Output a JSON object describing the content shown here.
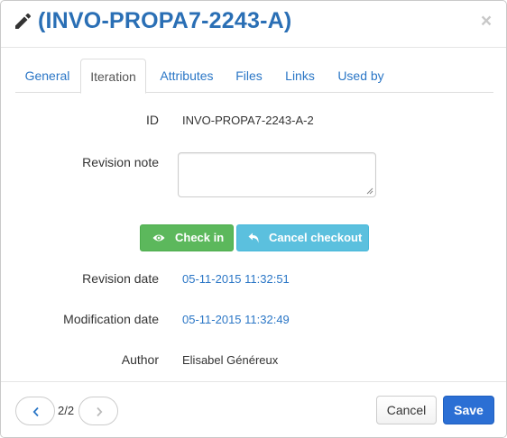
{
  "dialog": {
    "title": "(INVO-PROPA7-2243-A)",
    "close_label": "×"
  },
  "tabs": [
    {
      "label": "General",
      "active": false
    },
    {
      "label": "Iteration",
      "active": true
    },
    {
      "label": "Attributes",
      "active": false
    },
    {
      "label": "Files",
      "active": false
    },
    {
      "label": "Links",
      "active": false
    },
    {
      "label": "Used by",
      "active": false
    }
  ],
  "iteration": {
    "id_label": "ID",
    "id_value": "INVO-PROPA7-2243-A-2",
    "revision_note_label": "Revision note",
    "revision_note_value": "",
    "checkin_label": "Check in",
    "cancel_checkout_label": "Cancel checkout",
    "revision_date_label": "Revision date",
    "revision_date_value": "05-11-2015 11:32:51",
    "modification_date_label": "Modification date",
    "modification_date_value": "05-11-2015 11:32:49",
    "author_label": "Author",
    "author_value": "Elisabel Généreux"
  },
  "footer": {
    "pager": "2/2",
    "cancel_label": "Cancel",
    "save_label": "Save"
  },
  "icons": {
    "title": "pencil-icon",
    "checkin": "eye-icon",
    "cancel_checkout": "undo-arrow-icon",
    "prev": "chevron-left-icon",
    "next": "chevron-right-icon"
  },
  "colors": {
    "title": "#2a6fb5",
    "link": "#2a76c6",
    "checkin": "#5cb85c",
    "cancel_checkout": "#5bc0de",
    "save": "#2b6fd4"
  }
}
